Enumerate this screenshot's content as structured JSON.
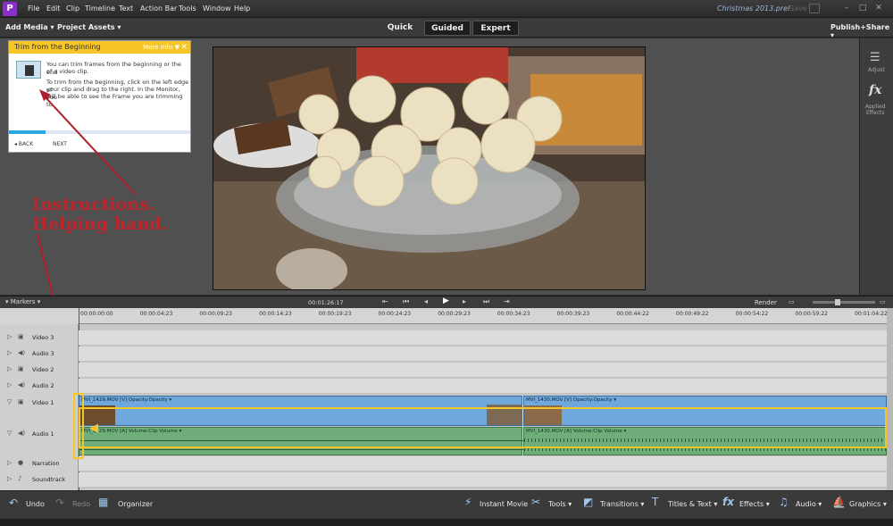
{
  "app": {
    "logo_icon": "premiere-elements-logo",
    "project_title": "Christmas 2013.prel",
    "save_label": "Save"
  },
  "menu": [
    "File",
    "Edit",
    "Clip",
    "Timeline",
    "Text",
    "Action Bar",
    "Tools",
    "Window",
    "Help"
  ],
  "toolbar": {
    "add_media": "Add Media ▾",
    "project_assets": "Project Assets ▾",
    "publish": "Publish+Share ▾"
  },
  "modes": {
    "quick": "Quick",
    "guided": "Guided",
    "expert": "Expert"
  },
  "right_panel": {
    "adjust": "Adjust",
    "effects_line1": "Applied",
    "effects_line2": "Effects"
  },
  "guide": {
    "title": "Trim from the Beginning",
    "more_info": "More Info",
    "close": "✕",
    "text1a": "You can trim frames from the beginning or the end",
    "text1b": "of a video clip.",
    "text2a": "To trim from the beginning, click on the left edge of",
    "text2b": "your clip and drag to the right. In the Monitor, you",
    "text2c": "will be able to see the Frame you are trimming to.",
    "back": "◂  BACK",
    "next": "NEXT",
    "progress": 0.2
  },
  "annotation": {
    "line1": "Instructions.",
    "line2": "Helping hand."
  },
  "timeline_bar": {
    "markers": "▾  Markers  ▾",
    "timecode": "00:01:26:17",
    "render": "Render"
  },
  "ruler": [
    "00:00:00:00",
    "00:00:04:23",
    "00:00:09:23",
    "00:00:14:23",
    "00:00:19:23",
    "00:00:24:23",
    "00:00:29:23",
    "00:00:34:23",
    "00:00:39:23",
    "00:00:44:22",
    "00:00:49:22",
    "00:00:54:22",
    "00:00:59:22",
    "00:01:04:22"
  ],
  "tracks": [
    {
      "name": "Video 3",
      "kind": "video"
    },
    {
      "name": "Audio 3",
      "kind": "audio"
    },
    {
      "name": "Video 2",
      "kind": "video"
    },
    {
      "name": "Audio 2",
      "kind": "audio"
    },
    {
      "name": "Video 1",
      "kind": "video"
    },
    {
      "name": "Audio 1",
      "kind": "audio"
    },
    {
      "name": "Narration",
      "kind": "narration"
    },
    {
      "name": "Soundtrack",
      "kind": "soundtrack"
    }
  ],
  "clips": {
    "v1a": "MVI_1429.MOV [V]  Opacity:Opacity ▾",
    "v1b": "MVI_1430.MOV [V]  Opacity:Opacity ▾",
    "a1a": "MVI_1429.MOV [A]  Volume:Clip Volume ▾",
    "a1b": "MVI_1430.MOV [A]  Volume:Clip Volume ▾"
  },
  "bottom": {
    "undo": "Undo",
    "redo": "Redo",
    "organizer": "Organizer",
    "instant_movie": "Instant Movie",
    "tools": "Tools  ▾",
    "transitions": "Transitions  ▾",
    "titles": "Titles & Text  ▾",
    "effects": "Effects  ▾",
    "audio": "Audio  ▾",
    "graphics": "Graphics  ▾"
  },
  "colors": {
    "accent_yellow": "#f6c628",
    "annotation_red": "#c0252c",
    "video_clip": "#6ea8dc",
    "audio_clip": "#6fae7a"
  }
}
